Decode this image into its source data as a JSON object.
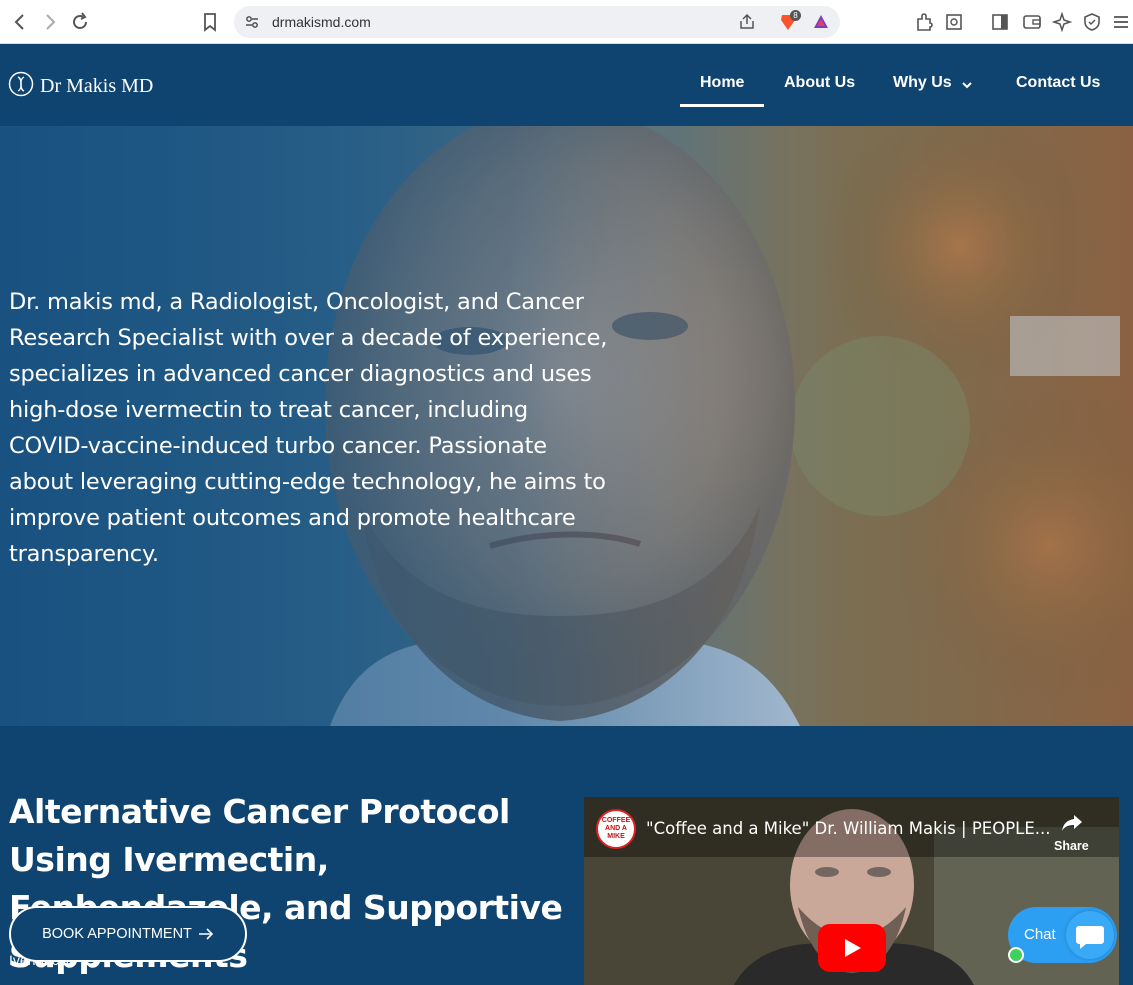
{
  "browser": {
    "url": "drmakismd.com",
    "brave_badge": "8"
  },
  "site": {
    "logo_text": "Dr Makis MD",
    "nav": [
      {
        "label": "Home"
      },
      {
        "label": "About Us"
      },
      {
        "label": "Why Us"
      },
      {
        "label": "Contact Us"
      }
    ]
  },
  "hero": {
    "text": "Dr. makis md, a Radiologist, Oncologist, and Cancer Research Specialist with over a decade of experience, specializes in advanced cancer diagnostics and uses high-dose ivermectin to treat cancer, including COVID-vaccine-induced turbo cancer. Passionate about leveraging cutting-edge technology, he aims to improve patient outcomes and promote healthcare transparency."
  },
  "section": {
    "title": "Alternative Cancer Protocol Using Ivermectin, Fenbendazole, and Supportive Supplements",
    "book_button": "BOOK APPOINTMENT",
    "sub_label": "Ivermectin"
  },
  "video": {
    "channel_badge": "COFFEE AND A MIKE",
    "title": "\"Coffee and a Mike\" Dr. William Makis | PEOPLE...",
    "share_label": "Share"
  },
  "chat": {
    "label": "Chat"
  },
  "colors": {
    "header_bg": "#0f4470",
    "chat_bg": "#2c9ff3",
    "youtube_red": "#ff0000"
  }
}
